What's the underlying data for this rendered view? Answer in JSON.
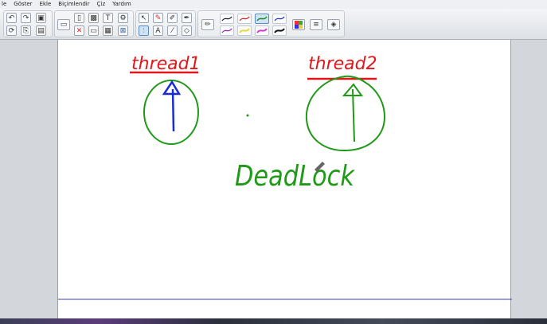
{
  "menu": [
    "le",
    "Göster",
    "Ekle",
    "Biçimlendir",
    "Çiz",
    "Yardım"
  ],
  "board": {
    "label_thread1": "thread1",
    "label_thread2": "thread2",
    "label_deadlock": "DeadLock"
  },
  "colors": {
    "red_ink": "#e3161b",
    "green_ink": "#1f9a17",
    "blue_ink": "#1a2bd8",
    "toolbar_bg": "#e7eaee",
    "canvas_bg": "#ffffff"
  },
  "icons": [
    "undo-icon",
    "redo-icon",
    "gallery-icon",
    "refresh-icon",
    "attach-icon",
    "save-icon",
    "screen-shade-icon",
    "new-page-icon",
    "delete-page-icon",
    "image-icon",
    "hide-icon",
    "text-box-icon",
    "table-icon",
    "gear-icon",
    "fullscreen-icon",
    "select-icon",
    "pen-icon",
    "highlighter-icon",
    "eraser-icon",
    "text-icon",
    "line-icon",
    "shape-icon",
    "creative-pen-icon",
    "fill-icon",
    "color-palette-icon",
    "line-style-icon",
    "properties-icon"
  ]
}
